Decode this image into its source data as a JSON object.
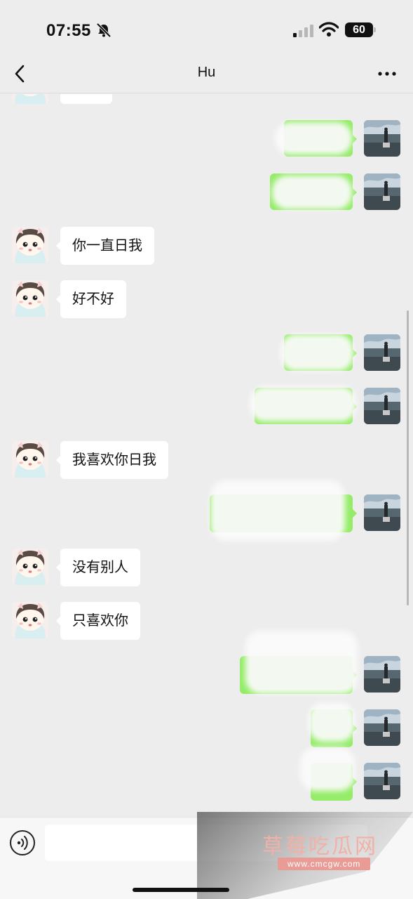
{
  "status_bar": {
    "time": "07:55",
    "battery": "60"
  },
  "nav": {
    "title": "Hu"
  },
  "messages": [
    {
      "sender": "contact",
      "text": "你一直日我"
    },
    {
      "sender": "contact",
      "text": "好不好"
    },
    {
      "sender": "contact",
      "text": "我喜欢你日我"
    },
    {
      "sender": "contact",
      "text": "没有别人"
    },
    {
      "sender": "contact",
      "text": "只喜欢你"
    }
  ],
  "watermark": {
    "text": "草莓吃瓜网",
    "url": "www.cmcgw.com"
  },
  "colors": {
    "background": "#ededed",
    "outgoing_bubble": "#95ec69",
    "incoming_bubble": "#ffffff"
  }
}
